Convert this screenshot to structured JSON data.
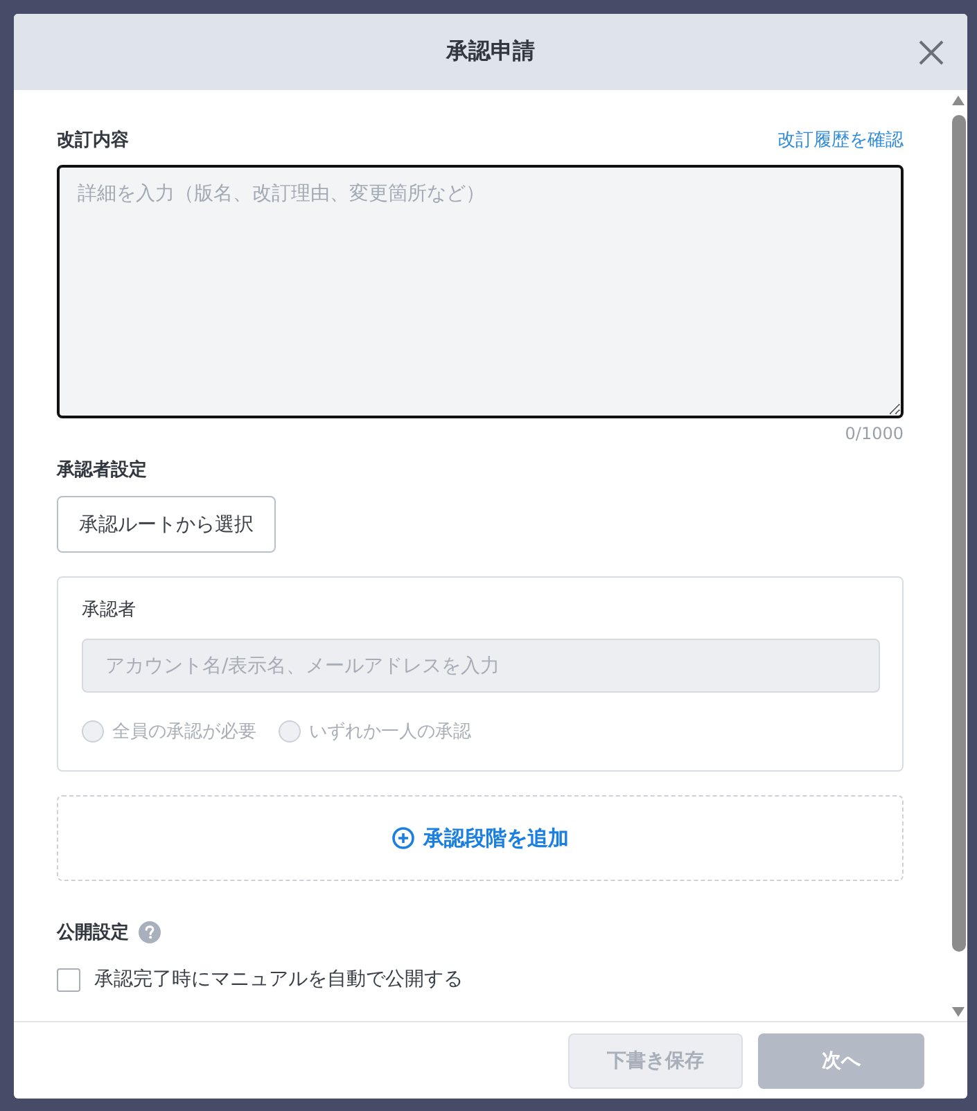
{
  "dialog": {
    "title": "承認申請"
  },
  "revision": {
    "label": "改訂内容",
    "history_link": "改訂履歴を確認",
    "textarea": {
      "placeholder": "詳細を入力（版名、改訂理由、変更箇所など）",
      "focused": true
    },
    "counter": "0/1000"
  },
  "approver_settings": {
    "label": "承認者設定",
    "route_button": "承認ルートから選択",
    "steps": [
      {
        "label": "承認者",
        "input": {
          "placeholder": "アカウント名/表示名、メールアドレスを入力",
          "disabled": true
        },
        "options": [
          {
            "label": "全員の承認が必要",
            "selected": false,
            "disabled": true
          },
          {
            "label": "いずれか一人の承認",
            "selected": false,
            "disabled": true
          }
        ]
      }
    ],
    "add_step": "承認段階を追加"
  },
  "publish": {
    "label": "公開設定",
    "checkbox": {
      "label": "承認完了時にマニュアルを自動で公開する",
      "checked": false
    }
  },
  "footer": {
    "buttons": [
      {
        "label": "下書き保存",
        "kind": "secondary",
        "disabled": true
      },
      {
        "label": "次へ",
        "kind": "primary",
        "disabled": true
      }
    ]
  }
}
